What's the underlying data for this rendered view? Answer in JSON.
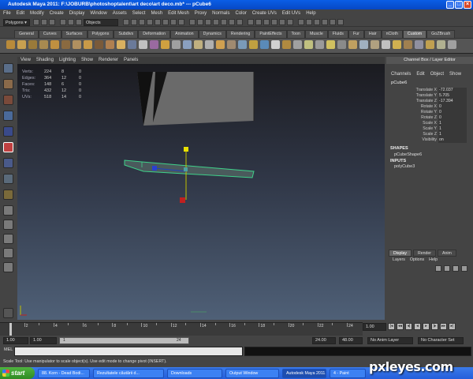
{
  "window": {
    "title": "Autodesk Maya 2011: F:\\JOBURB\\photoshoptalent\\art deco\\art deco.mb*   ---   pCube6"
  },
  "menubar": [
    "File",
    "Edit",
    "Modify",
    "Create",
    "Display",
    "Window",
    "Assets",
    "Select",
    "Mesh",
    "Edit Mesh",
    "Proxy",
    "Normals",
    "Color",
    "Create UVs",
    "Edit UVs",
    "Help"
  ],
  "statusline": {
    "menuset": "Polygons",
    "objects_field": "Objects"
  },
  "shelf_tabs": [
    "General",
    "Curves",
    "Surfaces",
    "Polygons",
    "Subdivs",
    "Deformation",
    "Animation",
    "Dynamics",
    "Rendering",
    "PaintEffects",
    "Toon",
    "Muscle",
    "Fluids",
    "Fur",
    "Hair",
    "nCloth",
    "Custom",
    "GoZBrush"
  ],
  "active_shelf_tab": "Custom",
  "panel_menu": [
    "View",
    "Shading",
    "Lighting",
    "Show",
    "Renderer",
    "Panels"
  ],
  "hud": {
    "rows": [
      {
        "label": "Verts:",
        "a": "224",
        "b": "8",
        "c": "0"
      },
      {
        "label": "Edges:",
        "a": "364",
        "b": "12",
        "c": "0"
      },
      {
        "label": "Faces:",
        "a": "148",
        "b": "6",
        "c": "0"
      },
      {
        "label": "Tris:",
        "a": "432",
        "b": "12",
        "c": "0"
      },
      {
        "label": "UVs:",
        "a": "518",
        "b": "14",
        "c": "0"
      }
    ]
  },
  "channel_box": {
    "title": "Channel Box / Layer Editor",
    "menu": [
      "Channels",
      "Edit",
      "Object",
      "Show"
    ],
    "object": "pCube6",
    "attributes": [
      {
        "name": "Translate X",
        "value": "-72.037"
      },
      {
        "name": "Translate Y",
        "value": "5.705"
      },
      {
        "name": "Translate Z",
        "value": "-17.394"
      },
      {
        "name": "Rotate X",
        "value": "0"
      },
      {
        "name": "Rotate Y",
        "value": "0"
      },
      {
        "name": "Rotate Z",
        "value": "0"
      },
      {
        "name": "Scale X",
        "value": "1"
      },
      {
        "name": "Scale Y",
        "value": "1"
      },
      {
        "name": "Scale Z",
        "value": "1"
      },
      {
        "name": "Visibility",
        "value": "on"
      }
    ],
    "shapes_header": "SHAPES",
    "shape": "pCubeShape6",
    "inputs_header": "INPUTS",
    "input": "polyCube3"
  },
  "layer_editor": {
    "tabs": [
      "Display",
      "Render",
      "Anim"
    ],
    "menu": [
      "Layers",
      "Options",
      "Help"
    ]
  },
  "timeslider": {
    "ticks": [
      "2",
      "4",
      "6",
      "8",
      "10",
      "12",
      "14",
      "16",
      "18",
      "20",
      "22",
      "24"
    ],
    "current_frame": "1.00"
  },
  "rangeslider": {
    "start": "1.00",
    "start2": "1.00",
    "bar_start": "1",
    "bar_end": "24",
    "end": "24.00",
    "end2": "48.00",
    "anim_layer": "No Anim Layer",
    "character_set": "No Character Set"
  },
  "cmdline": {
    "label": "MEL"
  },
  "helpline": "Scale Tool: Use manipulator to scale object(s). Use edit mode to change pivot (INSERT).",
  "taskbar": {
    "start": "start",
    "tasks": [
      "88. Korn - Dead Bodi...",
      "Rezultatele căutării d...",
      "Downloads",
      "Output Window",
      "Autodesk Maya 2011...",
      "4 - Paint"
    ],
    "active": "Autodesk Maya 2011..."
  },
  "watermark": "pxleyes.com",
  "colors": {
    "selection_green": "#3fd18a",
    "axis_y": "#c0c000",
    "axis_x": "#c02020",
    "axis_z": "#2040c0",
    "taskbar_blue": "#245edb"
  }
}
